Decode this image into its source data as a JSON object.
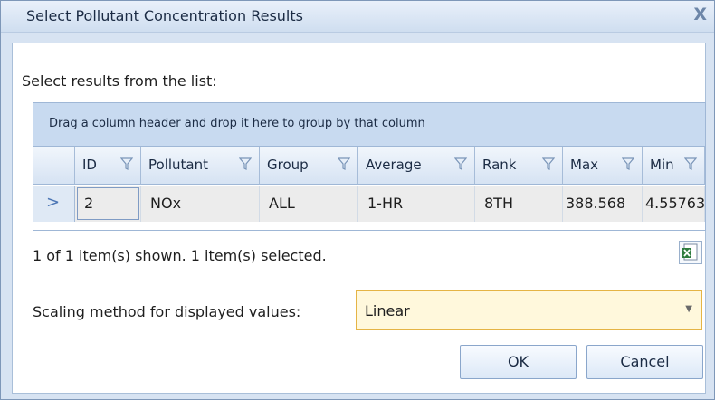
{
  "dialog": {
    "title": "Select Pollutant Concentration Results",
    "close_glyph": "X",
    "instruction": "Select results from the list:"
  },
  "grid": {
    "group_hint": "Drag a column header and drop it here to group by that column",
    "columns": [
      "ID",
      "Pollutant",
      "Group",
      "Average",
      "Rank",
      "Max",
      "Min"
    ],
    "rows": [
      [
        "2",
        "NOx",
        "ALL",
        "1-HR",
        "8TH",
        "388.568",
        "4.55763"
      ]
    ],
    "row_indicator": ">"
  },
  "status": "1 of 1 item(s) shown. 1 item(s) selected.",
  "export_icon": "excel-export-icon",
  "scaling": {
    "label": "Scaling method for displayed values:",
    "value": "Linear"
  },
  "buttons": {
    "ok": "OK",
    "cancel": "Cancel"
  },
  "colors": {
    "header_bg": "#c8daf0",
    "selected_row": "#ececec",
    "dropdown_border": "#e5b445",
    "accent": "#4c76b5"
  }
}
